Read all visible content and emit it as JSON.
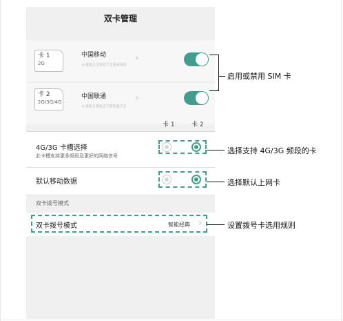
{
  "screen": {
    "title": "双卡管理",
    "sims": [
      {
        "badge_num": "卡 1",
        "badge_net": "2G",
        "carrier": "中国移动",
        "number": "+861390718440",
        "enabled": true
      },
      {
        "badge_num": "卡 2",
        "badge_net": "2G/3G/4G",
        "carrier": "中国联通",
        "number": "+861862785672",
        "enabled": true
      }
    ],
    "columns": {
      "card1": "卡 1",
      "card2": "卡 2"
    },
    "slot_select": {
      "label": "4G/3G 卡槽选择",
      "sub": "此卡槽支持更多频段及更好的网络信号",
      "selected": "卡 2"
    },
    "default_data": {
      "label": "默认移动数据",
      "selected": "卡 2"
    },
    "dial_section_header": "双卡拨号模式",
    "dial_mode": {
      "label": "双卡拨号模式",
      "value": "智能经典"
    }
  },
  "annotations": {
    "toggle": "启用或禁用 SIM 卡",
    "slot": "选择支持 4G/3G 频段的卡",
    "data": "选择默认上网卡",
    "dial": "设置拨号卡选用规则"
  },
  "colors": {
    "accent": "#3f9e8c",
    "background": "#f0f0f0"
  },
  "icons": [
    "chevron-right-icon",
    "toggle-switch",
    "radio-button"
  ]
}
